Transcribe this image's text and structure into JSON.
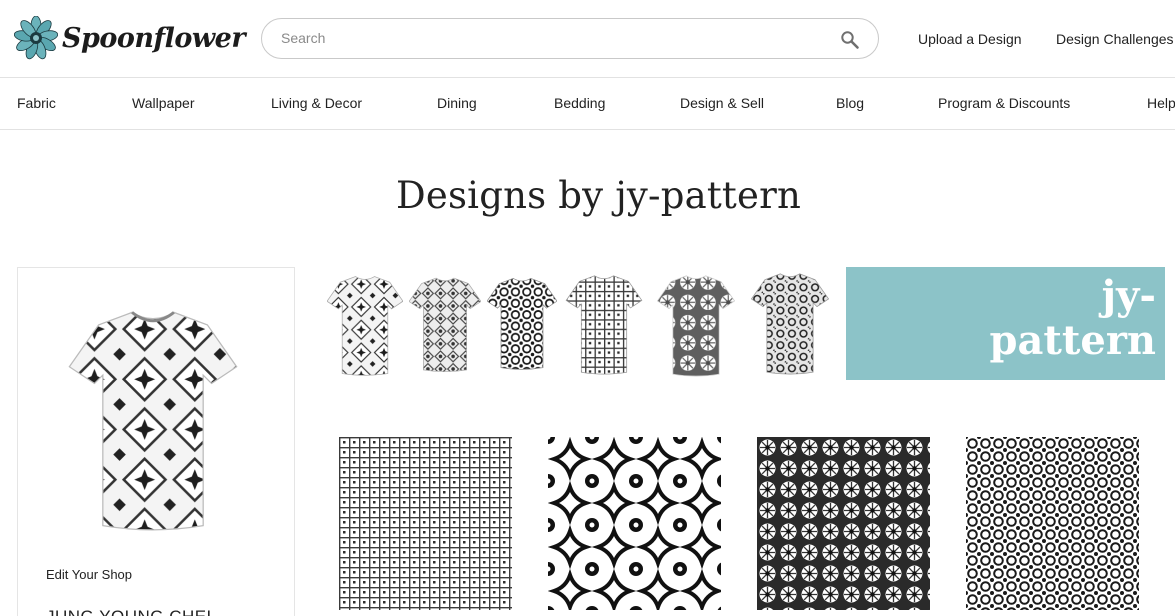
{
  "header": {
    "logo_text": "Spoonflower",
    "search_placeholder": "Search",
    "links": [
      "Upload a Design",
      "Design Challenges"
    ]
  },
  "nav": {
    "items": [
      "Fabric",
      "Wallpaper",
      "Living & Decor",
      "Dining",
      "Bedding",
      "Design & Sell",
      "Blog",
      "Program & Discounts",
      "Help"
    ]
  },
  "page": {
    "title": "Designs by jy-pattern"
  },
  "profile": {
    "edit_label": "Edit Your Shop",
    "name": "JUNG YOUNG CHEL"
  },
  "banner": {
    "line1": "jy-",
    "line2": "pattern"
  },
  "colors": {
    "banner_bg": "#8cc3c8",
    "logo_petal": "#5aa7b0",
    "border": "#e2e2e2"
  },
  "icons": {
    "logo": "flower-icon",
    "search": "search-icon"
  }
}
